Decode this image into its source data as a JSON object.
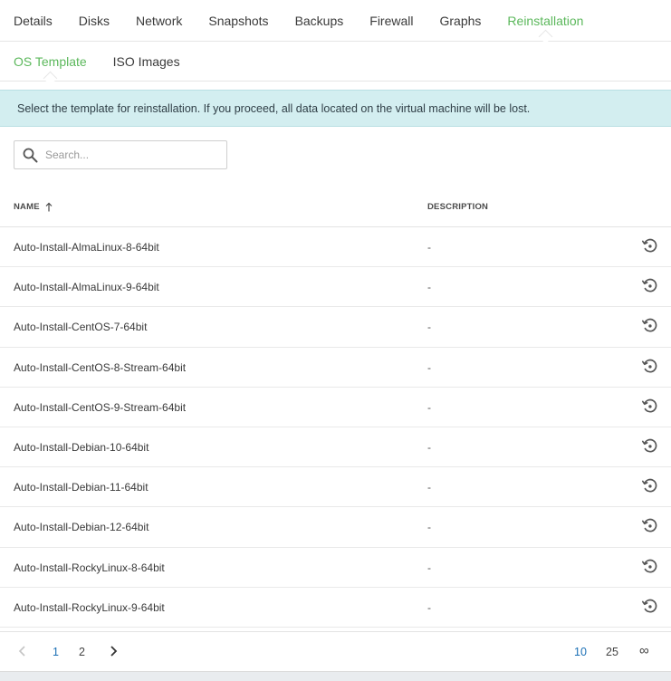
{
  "tabs": [
    {
      "label": "Details",
      "active": false
    },
    {
      "label": "Disks",
      "active": false
    },
    {
      "label": "Network",
      "active": false
    },
    {
      "label": "Snapshots",
      "active": false
    },
    {
      "label": "Backups",
      "active": false
    },
    {
      "label": "Firewall",
      "active": false
    },
    {
      "label": "Graphs",
      "active": false
    },
    {
      "label": "Reinstallation",
      "active": true
    }
  ],
  "subtabs": [
    {
      "label": "OS Template",
      "active": true
    },
    {
      "label": "ISO Images",
      "active": false
    }
  ],
  "alert": {
    "text": "Select the template for reinstallation. If you proceed, all data located on the virtual machine will be lost."
  },
  "search": {
    "placeholder": "Search...",
    "value": ""
  },
  "table": {
    "columns": {
      "name": "NAME",
      "description": "DESCRIPTION"
    },
    "sort": {
      "column": "name",
      "direction": "ascending",
      "icon": "arrow-up-icon"
    },
    "rows": [
      {
        "name": "Auto-Install-AlmaLinux-8-64bit",
        "description": "-"
      },
      {
        "name": "Auto-Install-AlmaLinux-9-64bit",
        "description": "-"
      },
      {
        "name": "Auto-Install-CentOS-7-64bit",
        "description": "-"
      },
      {
        "name": "Auto-Install-CentOS-8-Stream-64bit",
        "description": "-"
      },
      {
        "name": "Auto-Install-CentOS-9-Stream-64bit",
        "description": "-"
      },
      {
        "name": "Auto-Install-Debian-10-64bit",
        "description": "-"
      },
      {
        "name": "Auto-Install-Debian-11-64bit",
        "description": "-"
      },
      {
        "name": "Auto-Install-Debian-12-64bit",
        "description": "-"
      },
      {
        "name": "Auto-Install-RockyLinux-8-64bit",
        "description": "-"
      },
      {
        "name": "Auto-Install-RockyLinux-9-64bit",
        "description": "-"
      }
    ],
    "row_action_icon": "reinstall-restore-icon"
  },
  "pagination": {
    "pages": [
      "1",
      "2"
    ],
    "current_page": "1",
    "page_sizes": [
      "10",
      "25",
      "∞"
    ],
    "current_page_size": "10"
  },
  "colors": {
    "accent_green": "#5cb85c",
    "active_blue": "#1a6fb5",
    "alert_bg": "#d3eef0"
  }
}
